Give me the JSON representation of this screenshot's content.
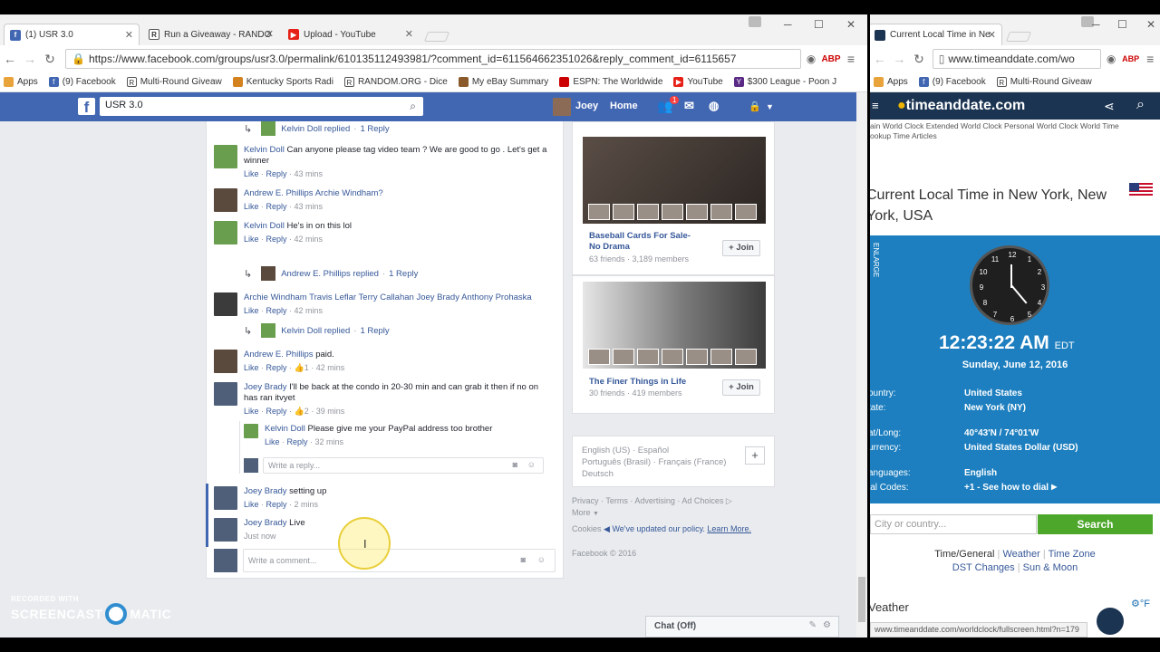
{
  "left_window": {
    "tabs": [
      {
        "title": "(1) USR 3.0",
        "icon": "facebook-icon"
      },
      {
        "title": "Run a Giveaway - RANDO",
        "icon": "random-org-icon"
      },
      {
        "title": "Upload - YouTube",
        "icon": "youtube-icon"
      }
    ],
    "url": "https://www.facebook.com/groups/usr3.0/permalink/610135112493981/?comment_id=611564662351026&reply_comment_id=6115657",
    "bookmarks": [
      "Apps",
      "(9) Facebook",
      "Multi-Round Giveaw",
      "Kentucky Sports Radi",
      "RANDOM.ORG - Dice",
      "My eBay Summary",
      "ESPN: The Worldwide",
      "YouTube",
      "$300 League - Poon J"
    ]
  },
  "facebook": {
    "search_value": "USR 3.0",
    "user_name": "Joey",
    "home_label": "Home",
    "friend_badge": "1",
    "comments": [
      {
        "kind": "reply_indicator",
        "name": "Kelvin Doll replied",
        "count": "1 Reply"
      },
      {
        "name": "Kelvin Doll",
        "text": "Can anyone please tag video team ? We are good to go . Let's get a winner",
        "like": "Like",
        "reply": "Reply",
        "time": "43 mins"
      },
      {
        "name": "Andrew E. Phillips",
        "text": "Archie Windham?",
        "like": "Like",
        "reply": "Reply",
        "time": "43 mins"
      },
      {
        "name": "Kelvin Doll",
        "text": "He's in on this lol",
        "like": "Like",
        "reply": "Reply",
        "time": "42 mins"
      },
      {
        "kind": "reply_indicator",
        "name": "Andrew E. Phillips replied",
        "count": "1 Reply"
      },
      {
        "name": "Archie Windham",
        "text": "Travis Leflar Terry Callahan Joey Brady Anthony Prohaska",
        "like": "Like",
        "reply": "Reply",
        "time": "42 mins"
      },
      {
        "kind": "reply_indicator",
        "name": "Kelvin Doll replied",
        "count": "1 Reply"
      },
      {
        "name": "Andrew E. Phillips",
        "text": "paid.",
        "like": "Like",
        "reply": "Reply",
        "likes": "1",
        "time": "42 mins"
      },
      {
        "name": "Joey Brady",
        "text": "I'll be back at the condo in 20-30 min and can grab it then if no on has ran itvyet",
        "like": "Like",
        "reply": "Reply",
        "likes": "2",
        "time": "39 mins"
      },
      {
        "name": "Kelvin Doll",
        "text": "Please give me your PayPal address too brother",
        "like": "Like",
        "reply": "Reply",
        "time": "32 mins"
      },
      {
        "name": "Joey Brady",
        "text": "setting up",
        "like": "Like",
        "reply": "Reply",
        "time": "2 mins"
      },
      {
        "name": "Joey Brady",
        "text": "Live",
        "time": "Just now"
      }
    ],
    "write_reply_placeholder": "Write a reply...",
    "write_comment_placeholder": "Write a comment...",
    "groups": [
      {
        "title": "Baseball Cards For Sale-No Drama",
        "title_l1": "Baseball Cards For Sale-",
        "title_l2": "No Drama",
        "stats": "63 friends · 3,189 members",
        "join": "+ Join"
      },
      {
        "title": "The Finer Things in Life",
        "stats": "30 friends · 419 members",
        "join": "+ Join"
      }
    ],
    "languages": {
      "l1": "English (US) · Español",
      "l2": "Português (Brasil) · Français (France)",
      "l3": "Deutsch"
    },
    "footer": {
      "l1": "Privacy · Terms · Advertising · Ad Choices",
      "l2": "More",
      "l3": "Cookies",
      "policy": "We've updated our policy.",
      "learn": "Learn More.",
      "copyright": "Facebook © 2016"
    },
    "chat_label": "Chat (Off)"
  },
  "watermark": {
    "l1": "RECORDED WITH",
    "l2a": "SCREENCAST",
    "l2b": "MATIC"
  },
  "right_window": {
    "tab_title": "Current Local Time in Ne",
    "url": "www.timeanddate.com/wo",
    "bookmarks": [
      "Apps",
      "(9) Facebook",
      "Multi-Round Giveaw"
    ],
    "logo": "timeanddate.com",
    "links_l1": "Main World Clock · Extended World Clock · Personal World Clock · World Time",
    "links_l1_visible": "ain World Clock  Extended World Clock  Personal World Clock  World Time",
    "links_l2": "ookup  Time Articles",
    "title": "Current Local Time in New York, New York, USA",
    "enlarge": "ENLARGE",
    "time": "12:23:22 AM",
    "tz": "EDT",
    "date": "Sunday, June 12, 2016",
    "info": [
      {
        "k": "Country:",
        "v": "United States"
      },
      {
        "k": "State:",
        "v": "New York (NY)"
      },
      {
        "k": "Lat/Long:",
        "v": "40°43'N / 74°01'W"
      },
      {
        "k": "Currency:",
        "v": "United States Dollar (USD)"
      },
      {
        "k": "Languages:",
        "v": "English"
      },
      {
        "k": "Dial Codes:",
        "v": "+1 - See how to dial"
      }
    ],
    "info_visible_keys": [
      "ountry:",
      "tate:",
      "at/Long:",
      "urrency:",
      "anguages:",
      "ial Codes:"
    ],
    "search_placeholder": "City or country...",
    "search_btn": "Search",
    "nav_l1a": "Time/General",
    "nav_l1b": "Weather",
    "nav_l1c": "Time Zone",
    "nav_l2a": "DST Changes",
    "nav_l2b": "Sun & Moon",
    "weather_label": "Weather",
    "weather_visible": "Veather",
    "unit": "°F",
    "status_url": "www.timeanddate.com/worldclock/fullscreen.html?n=179"
  }
}
